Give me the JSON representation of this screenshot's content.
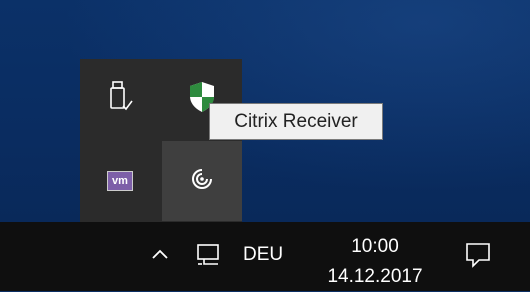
{
  "tray_flyout": {
    "icons": [
      {
        "name": "usb-safely-remove-icon"
      },
      {
        "name": "windows-defender-shield-icon"
      },
      {
        "name": "vmware-tools-icon",
        "label": "vm"
      },
      {
        "name": "citrix-receiver-icon"
      }
    ]
  },
  "tooltip": {
    "text": "Citrix Receiver"
  },
  "taskbar": {
    "language": "DEU",
    "time": "10:00",
    "date": "14.12.2017"
  },
  "colors": {
    "taskbar_bg": "#0f0f0f",
    "flyout_bg": "#2b2b2b",
    "flyout_hover": "#3f3f3f",
    "defender_green": "#2e8b3e",
    "vm_purple": "#7d5fa8"
  }
}
